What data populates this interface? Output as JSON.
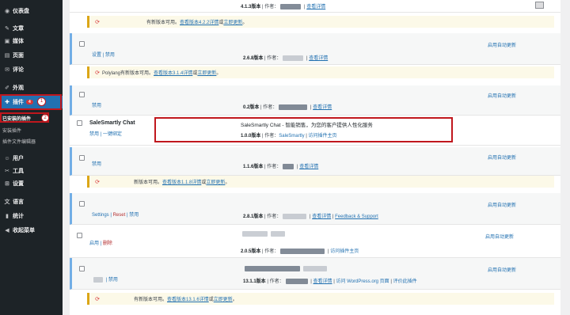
{
  "sidebar": {
    "items": [
      {
        "icon": "◉",
        "label": "仪表盘"
      },
      {
        "icon": "✎",
        "label": "文章"
      },
      {
        "icon": "▣",
        "label": "媒体"
      },
      {
        "icon": "▤",
        "label": "页面"
      },
      {
        "icon": "✉",
        "label": "评论"
      },
      {
        "icon": "✐",
        "label": "外观"
      },
      {
        "icon": "✚",
        "label": "插件",
        "badge": "4"
      },
      {
        "icon": "☺",
        "label": "用户"
      },
      {
        "icon": "✂",
        "label": "工具"
      },
      {
        "icon": "⊞",
        "label": "设置"
      },
      {
        "icon": "文",
        "label": "语言"
      },
      {
        "icon": "▮",
        "label": "统计"
      },
      {
        "icon": "◀",
        "label": "收起菜单"
      }
    ],
    "submenu": [
      "已安装的插件",
      "安装插件",
      "插件文件编辑器"
    ],
    "step1": "1",
    "step2": "2"
  },
  "rows": {
    "r0": {
      "meta_ver": "4.1.3版本",
      "meta_by": "作者：",
      "details": "查看详情"
    },
    "n0": {
      "icon": "⟳",
      "pre": "有新版本可用。",
      "link": "查看版本4.2.2详情",
      "or": "或",
      "upd": "立即更新",
      "end": "。"
    },
    "r1": {
      "actions": "设置 | 禁用",
      "meta_ver": "2.6.8版本",
      "meta_by": "作者：",
      "details": "查看详情",
      "auto": "启用自动更新"
    },
    "n1": {
      "icon": "⟳",
      "pre": "Polylang有新版本可用。",
      "link": "查看版本3.1.4详情",
      "or": "或",
      "upd": "立即更新",
      "end": "。"
    },
    "r2": {
      "actions": "禁用",
      "meta_ver": "0.2版本",
      "meta_by": "作者：",
      "details": "查看详情",
      "auto": "启用自动更新"
    },
    "ss": {
      "name": "SaleSmartly Chat",
      "actions": "禁用 | 一键绑定",
      "desc": "SaleSmartly Chat - 智能销售，为您的客户提供人性化服务",
      "meta_ver": "1.0.0版本",
      "meta_by": "作者：",
      "author": "SaleSmartly",
      "home": "访问插件主页"
    },
    "r3": {
      "actions": "禁用",
      "meta_ver": "1.1.6版本",
      "meta_by": "作者：",
      "details": "查看详情",
      "auto": "启用自动更新"
    },
    "n3": {
      "icon": "⟳",
      "pre": "新版本可用。",
      "link": "查看版本1.1.8详情",
      "or": "或",
      "upd": "立即更新",
      "end": "。"
    },
    "r4": {
      "settings": "Settings",
      "reset": "Reset",
      "disable": "禁用",
      "meta_ver": "2.8.1版本",
      "meta_by": "作者：",
      "details": "查看详情",
      "feedback": "Feedback & Support",
      "auto": "启用自动更新"
    },
    "r5": {
      "enable": "启用",
      "delete": "删除",
      "meta_ver": "2.0.5版本",
      "meta_by": "作者：",
      "home": "访问插件主页",
      "auto": "启用自动更新"
    },
    "r6": {
      "actions": "禁用",
      "meta_ver": "13.1.1版本",
      "meta_by": "作者：",
      "details": "查看详情",
      "wp": "访问 WordPress.org 页面",
      "rate": "评价此插件",
      "auto": "启用自动更新"
    },
    "n6": {
      "icon": "⟳",
      "pre": "有新版本可用。",
      "link": "查看版本13.1.6详情",
      "or": "或",
      "upd": "立即更新",
      "end": "。"
    }
  },
  "colors": {
    "sidebar_bg": "#1d2327",
    "accent": "#2271b1",
    "highlight": "#c0171d",
    "notice_bg": "#fcf9e8"
  }
}
